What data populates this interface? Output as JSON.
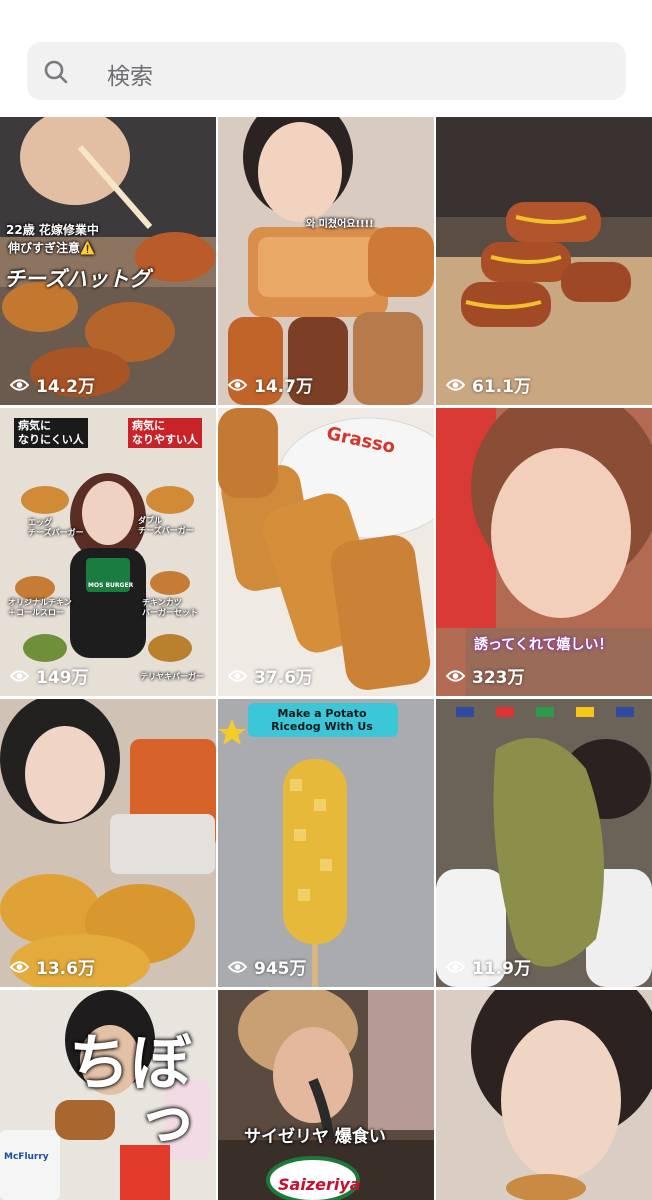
{
  "search": {
    "placeholder": "検索"
  },
  "tiles": [
    {
      "views": "14.2万",
      "caption_top": "22歳 花嫁修業中",
      "caption_mid": "伸びすぎ注意⚠️",
      "caption_big": "チーズハットグ",
      "bg": "#9c7b5b"
    },
    {
      "views": "14.7万",
      "caption_top": "와 미쳤어요!!!!",
      "bg": "#c9b39b"
    },
    {
      "views": "61.1万",
      "bg": "#7a6a5a"
    },
    {
      "views": "149万",
      "caption_left": "病気に\nなりにくい人",
      "caption_right": "病気に\nなりやすい人",
      "label_1": "エッグ\nチーズバーガー",
      "label_2": "ダブル\nチーズバーガー",
      "label_3": "オリジナルチキン\n＋コールスロー",
      "label_4": "チキンカツ\nバーガーセット",
      "label_5": "テリヤキバーガー",
      "logo_text": "MOS BURGER",
      "bg": "#d8cfc6"
    },
    {
      "views": "37.6万",
      "plate_text": "Grasso",
      "bg": "#c98a3c"
    },
    {
      "views": "323万",
      "caption_bottom": "誘ってくれて嬉しい！",
      "bg": "#c9886a"
    },
    {
      "views": "13.6万",
      "bg": "#d9a441"
    },
    {
      "views": "945万",
      "banner": "Make a Potato Ricedog With Us",
      "bg": "#a6a8aa"
    },
    {
      "views": "11.9万",
      "bg": "#8b8a66"
    },
    {
      "views": "",
      "caption_vertical": "ぼっち",
      "cup_text": "McFlurry",
      "bg": "#e9e6e1"
    },
    {
      "views": "",
      "caption": "サイゼリヤ 爆食い",
      "logo_text": "Saizeriya",
      "bg": "#4a3a32"
    },
    {
      "views": "",
      "bg": "#d7c9be"
    }
  ]
}
